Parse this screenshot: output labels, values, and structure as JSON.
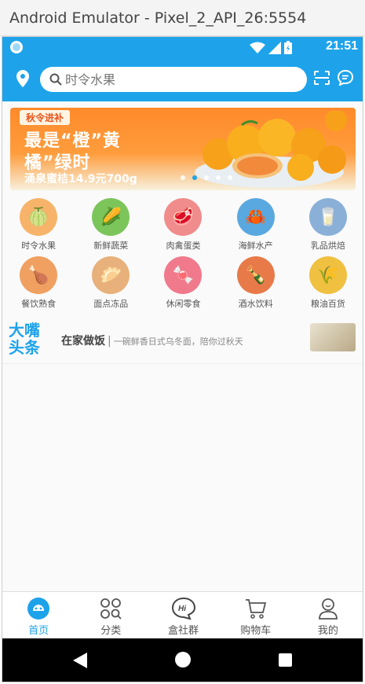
{
  "window": {
    "title": "Android Emulator - Pixel_2_API_26:5554"
  },
  "status_bar": {
    "time": "21:51"
  },
  "header": {
    "search_placeholder": "时令水果"
  },
  "banner": {
    "tag": "秋令进补",
    "title_line1": "最是“橙”黄",
    "title_line2": "橘”绿时",
    "subtitle": "涌泉蜜桔14.9元700g",
    "slide_count": 5,
    "active_slide": 1
  },
  "categories": [
    {
      "label": "时令水果",
      "color": "#f7b36a",
      "glyph": "🍈"
    },
    {
      "label": "新鲜蔬菜",
      "color": "#7cc55a",
      "glyph": "🌽"
    },
    {
      "label": "肉禽蛋类",
      "color": "#f08c8c",
      "glyph": "🥩"
    },
    {
      "label": "海鲜水产",
      "color": "#5aa8e0",
      "glyph": "🦀"
    },
    {
      "label": "乳品烘焙",
      "color": "#8ab0d8",
      "glyph": "🥛"
    },
    {
      "label": "餐饮熟食",
      "color": "#f0a060",
      "glyph": "🍗"
    },
    {
      "label": "面点冻品",
      "color": "#e8b07a",
      "glyph": "🥟"
    },
    {
      "label": "休闲零食",
      "color": "#f07a8c",
      "glyph": "🍬"
    },
    {
      "label": "酒水饮料",
      "color": "#e87a4a",
      "glyph": "🍾"
    },
    {
      "label": "粮油百货",
      "color": "#f0c040",
      "glyph": "🌾"
    }
  ],
  "headline": {
    "logo_line1": "大嘴",
    "logo_line2": "头条",
    "title": "在家做饭",
    "separator": "|",
    "description": "一碗鲜香日式乌冬面，陪你过秋天"
  },
  "tabs": [
    {
      "label": "首页",
      "icon": "home-icon",
      "active": true
    },
    {
      "label": "分类",
      "icon": "category-icon",
      "active": false
    },
    {
      "label": "盒社群",
      "icon": "community-icon",
      "active": false
    },
    {
      "label": "购物车",
      "icon": "cart-icon",
      "active": false
    },
    {
      "label": "我的",
      "icon": "profile-icon",
      "active": false
    }
  ],
  "colors": {
    "accent": "#1ea3ea",
    "banner": "#ff8a2a"
  }
}
